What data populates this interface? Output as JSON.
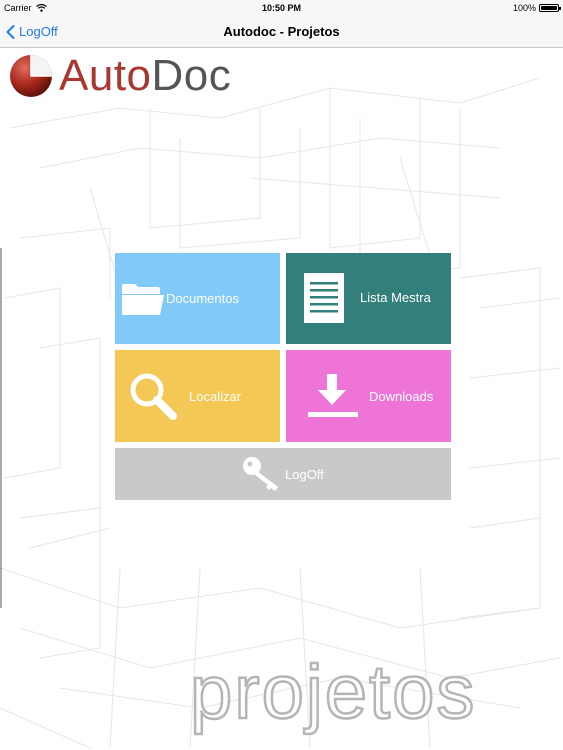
{
  "status_bar": {
    "carrier": "Carrier",
    "time": "10:50 PM",
    "battery": "100%"
  },
  "nav": {
    "back_label": "LogOff",
    "title": "Autodoc - Projetos"
  },
  "logo": {
    "part1": "Auto",
    "part2": "Doc"
  },
  "tiles": [
    {
      "label": "Documentos",
      "icon": "folder-icon",
      "color": "#80c9f9"
    },
    {
      "label": "Lista Mestra",
      "icon": "document-list-icon",
      "color": "#337f7b"
    },
    {
      "label": "Localizar",
      "icon": "magnifier-icon",
      "color": "#f4c855"
    },
    {
      "label": "Downloads",
      "icon": "download-icon",
      "color": "#ee74d8"
    },
    {
      "label": "LogOff",
      "icon": "key-icon",
      "color": "#c9c9c9"
    }
  ],
  "watermark": "projetos",
  "colors": {
    "nav_tint": "#1f7cf2",
    "logo_red": "#a7372f",
    "logo_gray": "#555555"
  }
}
